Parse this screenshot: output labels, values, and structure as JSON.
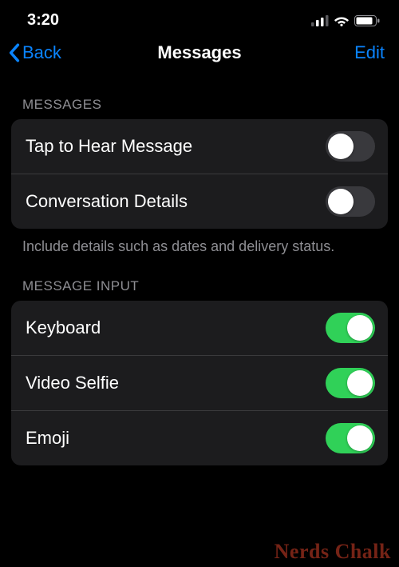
{
  "status": {
    "time": "3:20"
  },
  "nav": {
    "back_label": "Back",
    "title": "Messages",
    "edit_label": "Edit"
  },
  "sections": {
    "messages": {
      "header": "MESSAGES",
      "rows": {
        "tap_hear": {
          "label": "Tap to Hear Message",
          "on": false
        },
        "conv_details": {
          "label": "Conversation Details",
          "on": false
        }
      },
      "footer": "Include details such as dates and delivery status."
    },
    "input": {
      "header": "MESSAGE INPUT",
      "rows": {
        "keyboard": {
          "label": "Keyboard",
          "on": true
        },
        "video_selfie": {
          "label": "Video Selfie",
          "on": true
        },
        "emoji": {
          "label": "Emoji",
          "on": true
        }
      }
    }
  },
  "watermark": "Nerds Chalk"
}
